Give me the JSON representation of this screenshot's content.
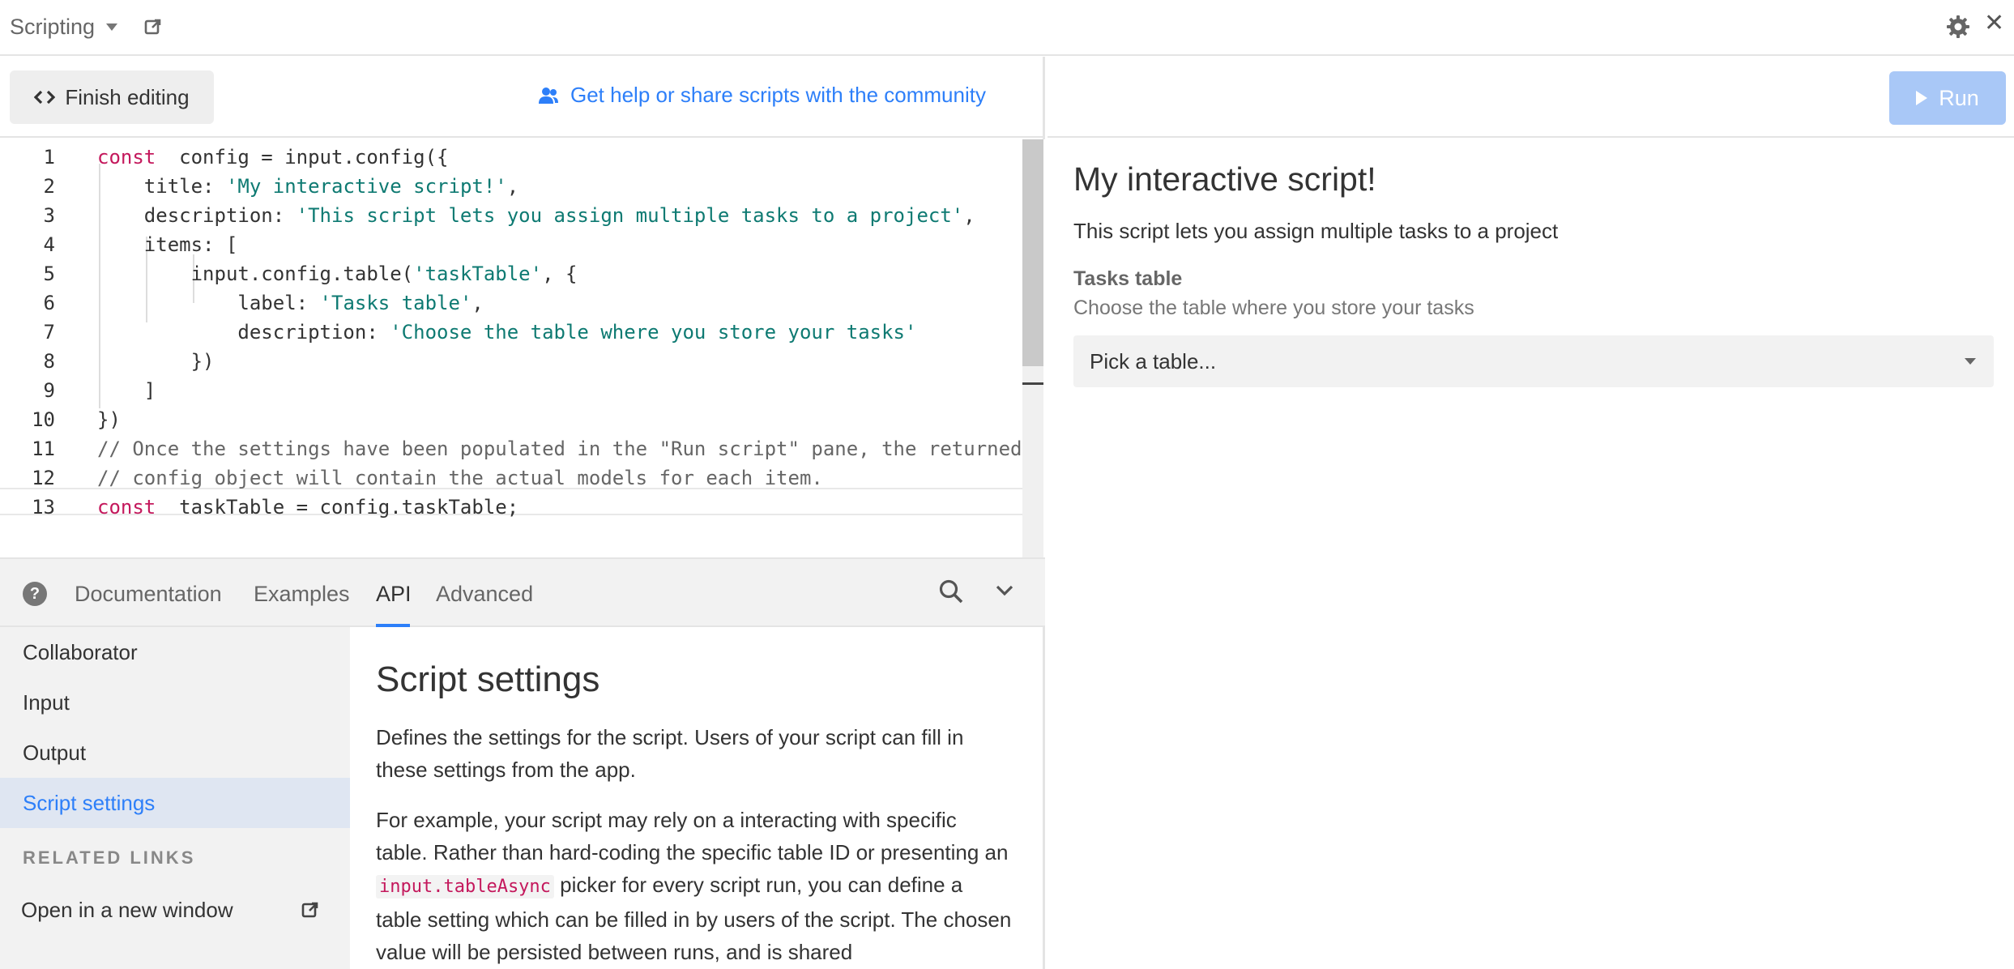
{
  "topbar": {
    "title": "Scripting",
    "icons": [
      "chevron-down-icon",
      "external-link-icon",
      "gear-icon",
      "close-icon"
    ],
    "close_glyph": "✕"
  },
  "editor_toolbar": {
    "finish_label": "Finish editing",
    "finish_icon_glyph": "<>",
    "help_link": "Get help or share scripts with the community"
  },
  "code": {
    "lines": [
      {
        "n": "1",
        "parts": [
          [
            "kw",
            "const"
          ],
          [
            "",
            "  config = input.config({"
          ]
        ]
      },
      {
        "n": "2",
        "parts": [
          [
            "",
            "    title: "
          ],
          [
            "str",
            "'My interactive script!'"
          ],
          [
            "",
            ","
          ]
        ]
      },
      {
        "n": "3",
        "parts": [
          [
            "",
            "    description: "
          ],
          [
            "str",
            "'This script lets you assign multiple tasks to a project'"
          ],
          [
            "",
            ","
          ]
        ]
      },
      {
        "n": "4",
        "parts": [
          [
            "",
            "    items: ["
          ]
        ]
      },
      {
        "n": "5",
        "parts": [
          [
            "",
            "        input.config.table("
          ],
          [
            "str",
            "'taskTable'"
          ],
          [
            "",
            ", {"
          ]
        ]
      },
      {
        "n": "6",
        "parts": [
          [
            "",
            "            label: "
          ],
          [
            "str",
            "'Tasks table'"
          ],
          [
            "",
            ","
          ]
        ]
      },
      {
        "n": "7",
        "parts": [
          [
            "",
            "            description: "
          ],
          [
            "str",
            "'Choose the table where you store your tasks'"
          ]
        ]
      },
      {
        "n": "8",
        "parts": [
          [
            "",
            "        })"
          ]
        ]
      },
      {
        "n": "9",
        "parts": [
          [
            "",
            "    ]"
          ]
        ]
      },
      {
        "n": "10",
        "parts": [
          [
            "",
            "})"
          ]
        ]
      },
      {
        "n": "11",
        "parts": [
          [
            "cm",
            "// Once the settings have been populated in the \"Run script\" pane, the returned"
          ]
        ]
      },
      {
        "n": "12",
        "parts": [
          [
            "cm",
            "// config object will contain the actual models for each item."
          ]
        ]
      },
      {
        "n": "13",
        "parts": [
          [
            "kw",
            "const"
          ],
          [
            "",
            "  taskTable = config.taskTable;"
          ]
        ]
      }
    ]
  },
  "docs_tabs": {
    "help_glyph": "?",
    "tabs": [
      "Documentation",
      "Examples",
      "API",
      "Advanced"
    ],
    "active": "API"
  },
  "docs_nav": {
    "items": [
      "Collaborator",
      "Input",
      "Output",
      "Script settings"
    ],
    "active": "Script settings",
    "related_heading": "RELATED LINKS",
    "open_new_window": "Open in a new window"
  },
  "docs_content": {
    "heading": "Script settings",
    "p1": "Defines the settings for the script. Users of your script can fill in these settings from the app.",
    "p2_before": "For example, your script may rely on a interacting with specific table. Rather than hard-coding the specific table ID or presenting an ",
    "p2_code": "input.tableAsync",
    "p2_after": " picker for every script run, you can define a table setting which can be filled in by users of the script. The chosen value will be persisted between runs, and is shared"
  },
  "run_pane": {
    "run_label": "Run",
    "title": "My interactive script!",
    "description": "This script lets you assign multiple tasks to a project",
    "field_label": "Tasks table",
    "field_description": "Choose the table where you store your tasks",
    "select_placeholder": "Pick a table..."
  }
}
